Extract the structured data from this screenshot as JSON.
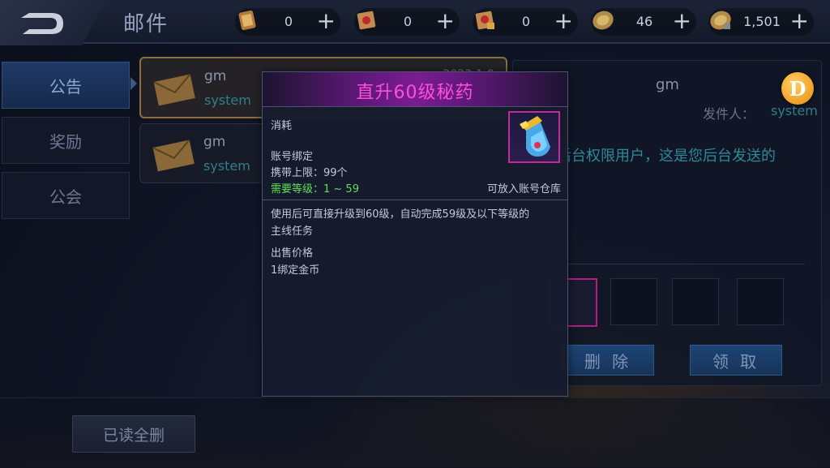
{
  "header": {
    "title": "邮件",
    "currencies": [
      {
        "icon": "scroll-icon",
        "value": "0"
      },
      {
        "icon": "red-ticket-icon",
        "value": "0"
      },
      {
        "icon": "locked-ticket-icon",
        "value": "0"
      },
      {
        "icon": "coin-icon",
        "value": "46"
      },
      {
        "icon": "bound-coin-icon",
        "value": "1,501"
      }
    ],
    "plus_label": "+"
  },
  "tabs": [
    {
      "label": "公告",
      "active": true
    },
    {
      "label": "奖励",
      "active": false
    },
    {
      "label": "公会",
      "active": false
    }
  ],
  "mails": [
    {
      "sender": "gm",
      "sub": "system",
      "date": "2023-1-9",
      "selected": true
    },
    {
      "sender": "gm",
      "sub": "system",
      "date": "",
      "selected": false
    }
  ],
  "detail": {
    "sender": "gm",
    "from_label": "发件人：",
    "from_value": "system",
    "body": "尊敬的后台权限用户，这是您后台发送的",
    "delete_label": "删 除",
    "claim_label": "领 取"
  },
  "badge_letter": "D",
  "footer": {
    "delete_all_label": "已读全删"
  },
  "tooltip": {
    "title": "直升60级秘药",
    "category": "消耗",
    "bind": "账号绑定",
    "stack": "携带上限：99个",
    "level_req": "需要等级：1 ~ 59",
    "storage": "可放入账号仓库",
    "description_line1": "使用后可直接升级到60级，自动完成59级及以下等级的",
    "description_line2": "主线任务",
    "sell_label": "出售价格",
    "sell_value": "1绑定金币",
    "title_color": "#ff4fd8",
    "req_color": "#5fe05a"
  }
}
